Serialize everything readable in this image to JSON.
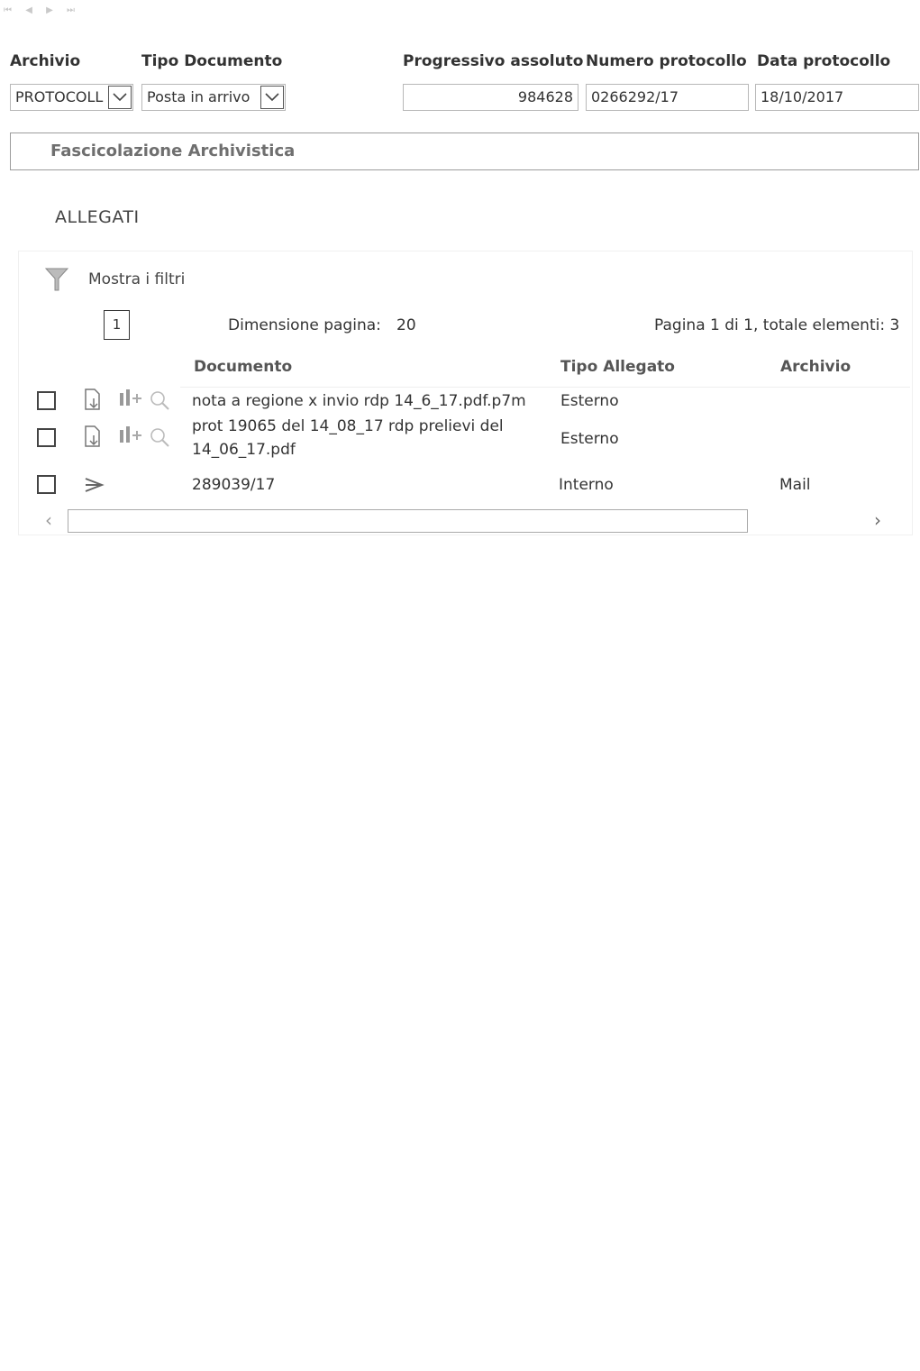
{
  "pager": {
    "first": "⏮",
    "prev": "◀",
    "next": "▶",
    "last": "⏭"
  },
  "labels": {
    "archivio": "Archivio",
    "tipo_documento": "Tipo Documento",
    "progressivo": "Progressivo assoluto",
    "numero_protocollo": "Numero protocollo",
    "data_protocollo": "Data protocollo"
  },
  "values": {
    "archivio": "PROTOCOLL",
    "tipo_documento": "Posta in arrivo",
    "progressivo": "984628",
    "numero_protocollo": "0266292/17",
    "data_protocollo": "18/10/2017"
  },
  "fascicolazione": "Fascicolazione Archivistica",
  "allegati": {
    "title": "ALLEGATI",
    "filter_label": "Mostra i filtri",
    "page_number": "1",
    "page_size_label": "Dimensione pagina:",
    "page_size": "20",
    "totals": "Pagina 1 di 1, totale elementi: 3",
    "columns": [
      "Documento",
      "Tipo Allegato",
      "Archivio"
    ],
    "rows": [
      {
        "doc": "nota a regione x invio rdp 14_6_17.pdf.p7m",
        "tipo": "Esterno",
        "archivio": ""
      },
      {
        "doc_line1": "prot 19065 del 14_08_17 rdp prelievi del",
        "doc_line2": "14_06_17.pdf",
        "tipo": "Esterno",
        "archivio": ""
      },
      {
        "doc": "289039/17",
        "tipo": "Interno",
        "archivio": "Mail"
      }
    ]
  },
  "icons": {
    "filter": "filter-icon",
    "download": "download-document-icon",
    "versions": "versions-icon",
    "preview": "preview-icon",
    "forward": "forward-icon"
  },
  "scroll": {
    "left": "‹",
    "right": "›"
  }
}
